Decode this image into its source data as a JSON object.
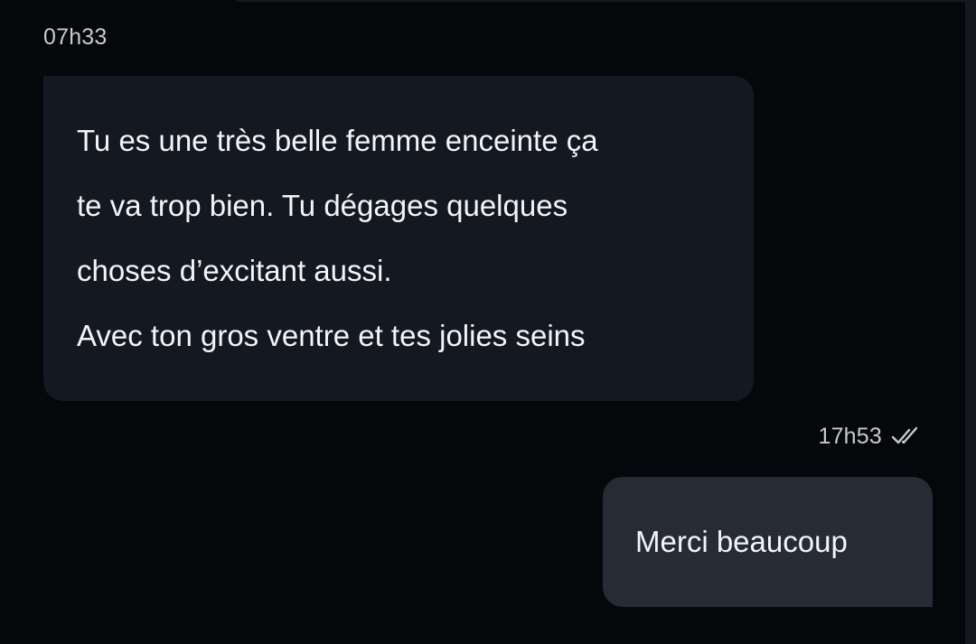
{
  "conversation": {
    "incoming": {
      "time": "07h33",
      "lines": [
        "Tu es une très belle femme enceinte ça",
        "te va trop bien. Tu dégages quelques",
        "choses d’excitant aussi.",
        "Avec ton gros ventre et tes jolies seins"
      ]
    },
    "outgoing": {
      "time": "17h53",
      "text": "Merci beaucoup",
      "status_icon": "double-check-icon"
    }
  },
  "colors": {
    "background": "#05070b",
    "incoming_bubble": "#141820",
    "outgoing_bubble": "#262b35",
    "text": "#f2f4f7",
    "timestamp": "#c7c9cd"
  }
}
